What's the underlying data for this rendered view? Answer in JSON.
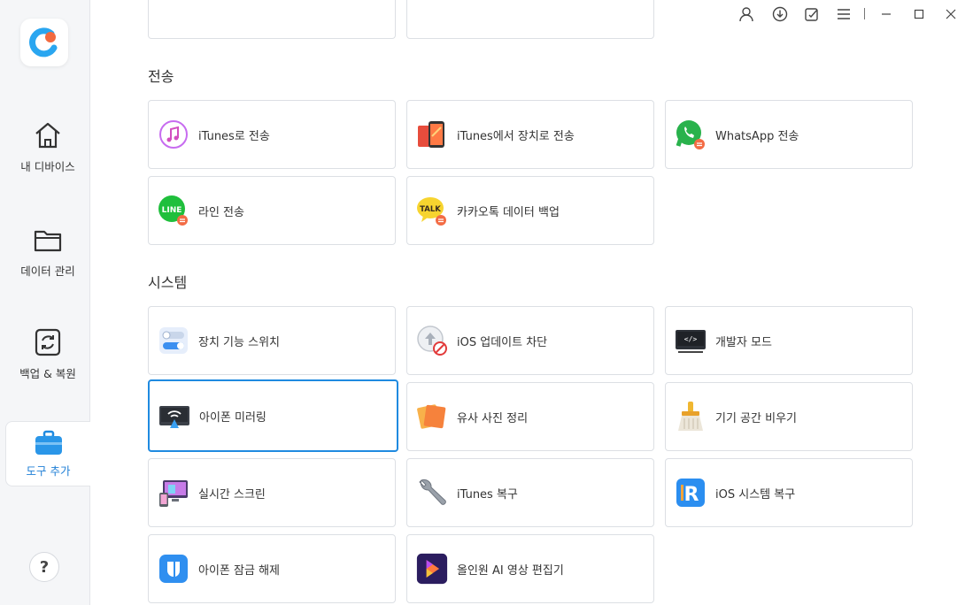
{
  "sidebar": {
    "items": [
      {
        "label": "내 디바이스",
        "icon": "home-icon"
      },
      {
        "label": "데이터 관리",
        "icon": "folder-icon"
      },
      {
        "label": "백업 & 복원",
        "icon": "backup-restore-icon"
      },
      {
        "label": "도구 추가",
        "icon": "toolbox-icon"
      }
    ],
    "help_label": "?"
  },
  "sections": {
    "transfer": {
      "title": "전송",
      "cards": [
        {
          "label": "iTunes로 전송",
          "icon": "itunes-music-icon"
        },
        {
          "label": "iTunes에서 장치로 전송",
          "icon": "phone-transfer-icon"
        },
        {
          "label": "WhatsApp 전송",
          "icon": "whatsapp-icon"
        },
        {
          "label": "라인 전송",
          "icon": "line-icon"
        },
        {
          "label": "카카오톡 데이터 백업",
          "icon": "kakaotalk-icon"
        }
      ]
    },
    "system": {
      "title": "시스템",
      "cards": [
        {
          "label": "장치 기능 스위치",
          "icon": "toggle-switch-icon"
        },
        {
          "label": "iOS 업데이트 차단",
          "icon": "block-update-icon"
        },
        {
          "label": "개발자 모드",
          "icon": "developer-terminal-icon"
        },
        {
          "label": "아이폰 미러링",
          "icon": "screen-mirroring-icon"
        },
        {
          "label": "유사 사진 정리",
          "icon": "photos-icon"
        },
        {
          "label": "기기 공간 비우기",
          "icon": "broom-icon"
        },
        {
          "label": "실시간 스크린",
          "icon": "live-screen-icon"
        },
        {
          "label": "iTunes 복구",
          "icon": "wrench-icon"
        },
        {
          "label": "iOS 시스템 복구",
          "icon": "reiboot-icon"
        },
        {
          "label": "아이폰 잠금 해제",
          "icon": "unlock-icon"
        },
        {
          "label": "올인원 AI 영상 편집기",
          "icon": "video-editor-icon"
        }
      ]
    }
  },
  "colors": {
    "accent": "#1f8ae0",
    "sidebar_bg": "#f5f6f8",
    "card_border": "#dcdfe4"
  }
}
